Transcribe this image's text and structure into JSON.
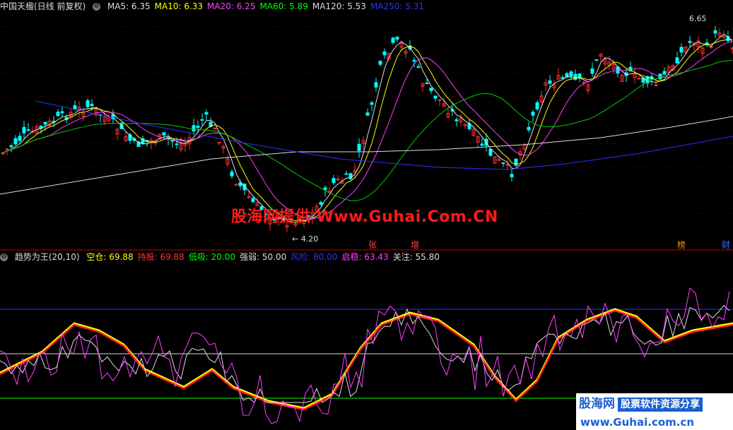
{
  "main_header": {
    "title": "中国天楹(日线 前复权)",
    "ma": [
      {
        "label": "MA5: 6.35",
        "color": "#dddddd"
      },
      {
        "label": "MA10: 6.33",
        "color": "#ffff00"
      },
      {
        "label": "MA20: 6.25",
        "color": "#ff40ff"
      },
      {
        "label": "MA60: 5.89",
        "color": "#00ff00"
      },
      {
        "label": "MA120: 5.53",
        "color": "#dddddd"
      },
      {
        "label": "MA250: 5.31",
        "color": "#3030ff"
      }
    ]
  },
  "price_labels": {
    "high": "6.65",
    "low": "4.20"
  },
  "watermark": "股海网提供 Www.Guhai.Com.CN",
  "event_markers": [
    {
      "label": "张",
      "color": "#ff4040"
    },
    {
      "label": "增",
      "color": "#ff4040"
    },
    {
      "label": "榜",
      "color": "#ff9000"
    },
    {
      "label": "财",
      "color": "#3c6bff"
    }
  ],
  "sub_header": {
    "title": "趋势为王(20,10)",
    "items": [
      {
        "label": "空仓: 69.88",
        "color": "#ffff00"
      },
      {
        "label": "持股: 69.88",
        "color": "#ff3030"
      },
      {
        "label": "低吸: 20.00",
        "color": "#00ff00"
      },
      {
        "label": "强弱: 50.00",
        "color": "#dddddd"
      },
      {
        "label": "风险: 80.00",
        "color": "#3030ff"
      },
      {
        "label": "启稳: 63.43",
        "color": "#ff40ff"
      },
      {
        "label": "关注: 55.80",
        "color": "#dddddd"
      }
    ]
  },
  "badge": {
    "brand": "股海网",
    "slogan": "股票软件资源分享",
    "url": "www.Guhai.com.cn"
  },
  "colors": {
    "up": "#ff3030",
    "down": "#00ffff",
    "grid": "#8b0000"
  }
}
